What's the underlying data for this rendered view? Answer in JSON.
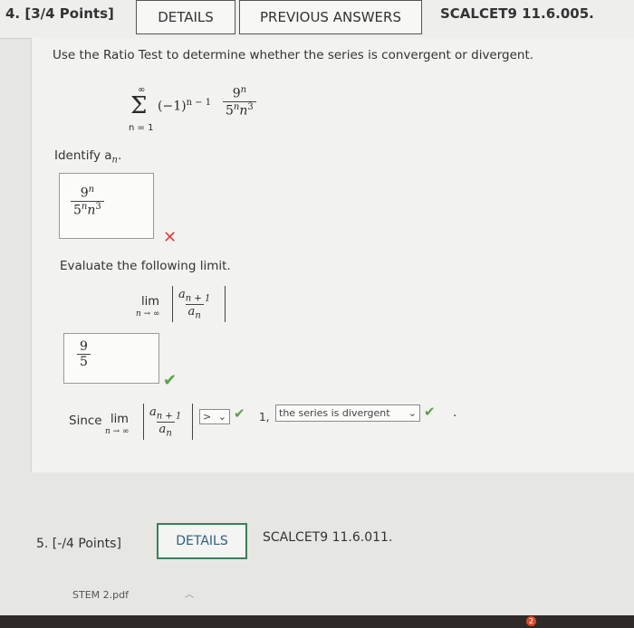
{
  "header": {
    "question": "4. [3/4 Points]",
    "details_label": "DETAILS",
    "previous_answers_label": "PREVIOUS ANSWERS",
    "code": "SCALCET9 11.6.005."
  },
  "prompt": "Use the Ratio Test to determine whether the series is convergent or divergent.",
  "series": {
    "sum_top": "∞",
    "sum_bottom": "n = 1",
    "sign_term": "(−1)",
    "sign_exp": "n − 1",
    "numerator": "9",
    "numerator_exp": "n",
    "denominator": "5",
    "denominator_exp1": "n",
    "denominator_var": "n",
    "denominator_exp2": "3"
  },
  "identify": {
    "label": "Identify a",
    "label_sub": "n",
    "label_end": ".",
    "answer_num": "9",
    "answer_num_exp": "n",
    "answer_den": "5",
    "answer_den_exp1": "n",
    "answer_den_var": "n",
    "answer_den_exp2": "3",
    "status_icon": "x-icon"
  },
  "limit": {
    "label": "Evaluate the following limit.",
    "lim": "lim",
    "lim_under": "n → ∞",
    "frac_num": "a",
    "frac_num_sub": "n + 1",
    "frac_den": "a",
    "frac_den_sub": "n",
    "answer_num": "9",
    "answer_den": "5",
    "status_icon": "check-icon"
  },
  "since": {
    "label": "Since",
    "lim": "lim",
    "lim_under": "n → ∞",
    "frac_num": "a",
    "frac_num_sub": "n + 1",
    "frac_den": "a",
    "frac_den_sub": "n",
    "comparison_value": ">",
    "after_text": "1,",
    "conclusion_value": "the series is divergent",
    "end_text": "."
  },
  "next_question": {
    "question": "5. [-/4 Points]",
    "details_label": "DETAILS",
    "code": "SCALCET9 11.6.011."
  },
  "download": {
    "filename": "STEM 2.pdf"
  },
  "taskbar": {
    "badge": "2"
  },
  "colors": {
    "check": "#5aa04a",
    "x": "#d44444",
    "details_border": "#3d7e57"
  }
}
